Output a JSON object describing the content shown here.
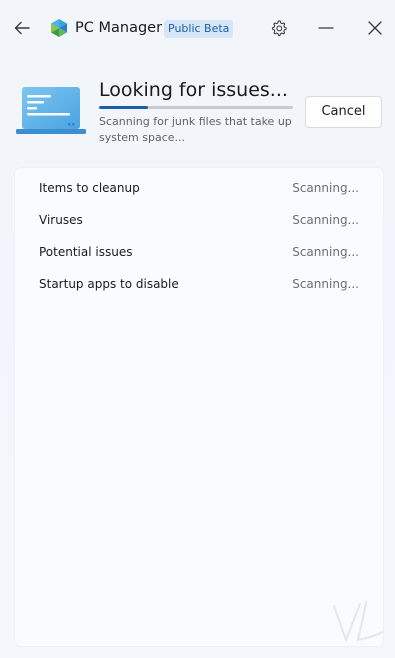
{
  "app": {
    "title": "PC Manager",
    "badge": "Public Beta"
  },
  "icons": {
    "back": "back-arrow-icon",
    "logo": "pc-manager-logo-icon",
    "settings": "gear-icon",
    "minimize": "minimize-icon",
    "close": "close-icon",
    "illustration": "laptop-scan-icon"
  },
  "scan": {
    "title": "Looking for issues...",
    "subtitle": "Scanning for junk files that take up system space...",
    "progress": 0.25,
    "cancel_label": "Cancel"
  },
  "results": {
    "items": [
      {
        "label": "Items to cleanup",
        "status": "Scanning..."
      },
      {
        "label": "Viruses",
        "status": "Scanning..."
      },
      {
        "label": "Potential issues",
        "status": "Scanning..."
      },
      {
        "label": "Startup apps to disable",
        "status": "Scanning..."
      }
    ]
  },
  "colors": {
    "accent": "#1a5fa8",
    "background": "#f3f7fc",
    "card": "#f9fbfe",
    "badge_bg": "#d6e6f7",
    "badge_text": "#1b5fa8"
  }
}
